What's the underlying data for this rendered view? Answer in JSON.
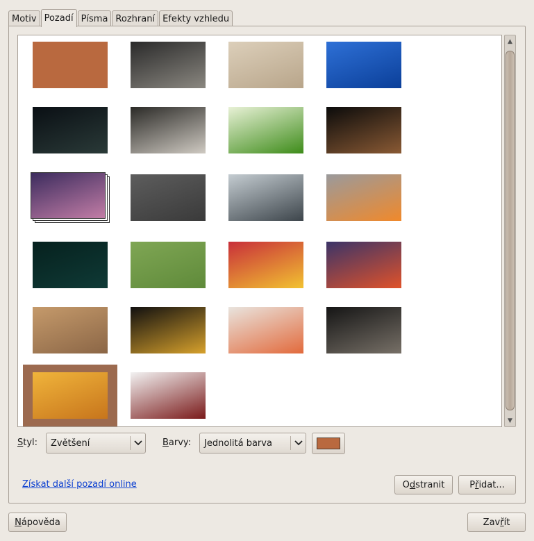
{
  "tabs": [
    {
      "label": "Motiv",
      "active": false
    },
    {
      "label": "Pozadí",
      "active": true
    },
    {
      "label": "Písma",
      "active": false
    },
    {
      "label": "Rozhraní",
      "active": false
    },
    {
      "label": "Efekty vzhledu",
      "active": false
    }
  ],
  "gallery": {
    "selected_index": 20,
    "items": [
      {
        "name": "solid-color",
        "colors": [
          "#b9693f",
          "#b9693f"
        ]
      },
      {
        "name": "dark-clouds-sea",
        "colors": [
          "#2a2a2a",
          "#8a8780"
        ]
      },
      {
        "name": "butterfly-flowers",
        "colors": [
          "#dccfba",
          "#b8a58a"
        ]
      },
      {
        "name": "rock-climber-sky",
        "colors": [
          "#2e70d6",
          "#0b3f99"
        ]
      },
      {
        "name": "water-lily",
        "colors": [
          "#0a0f14",
          "#2a3a38"
        ]
      },
      {
        "name": "hands-holding-frog",
        "colors": [
          "#2b2a27",
          "#cfcac2"
        ]
      },
      {
        "name": "green-grass",
        "colors": [
          "#e8f1d6",
          "#3e8c1a"
        ]
      },
      {
        "name": "cherries-on-crate",
        "colors": [
          "#0b0b0b",
          "#8a5a34"
        ]
      },
      {
        "name": "orion-nebula-stack",
        "colors": [
          "#3c2c5e",
          "#c27da6"
        ]
      },
      {
        "name": "cobblestone-shoes",
        "colors": [
          "#5d5d5d",
          "#3a3a3a"
        ]
      },
      {
        "name": "foggy-pier",
        "colors": [
          "#c4ccd1",
          "#3d454b"
        ]
      },
      {
        "name": "orange-flower",
        "colors": [
          "#9a9a9c",
          "#f0892b"
        ]
      },
      {
        "name": "moonlight-water",
        "colors": [
          "#06211e",
          "#0f3a36"
        ]
      },
      {
        "name": "green-leaf",
        "colors": [
          "#7fa654",
          "#5f8a3a"
        ]
      },
      {
        "name": "red-primrose",
        "colors": [
          "#c82f3a",
          "#f2c231"
        ]
      },
      {
        "name": "sunset-lake",
        "colors": [
          "#3b3468",
          "#e0522a"
        ]
      },
      {
        "name": "sand-dunes",
        "colors": [
          "#c59a6b",
          "#8b6646"
        ]
      },
      {
        "name": "dark-sunset-clouds",
        "colors": [
          "#111010",
          "#d7a12c"
        ]
      },
      {
        "name": "paint-brushes",
        "colors": [
          "#e9e4de",
          "#e26a3c"
        ]
      },
      {
        "name": "splashing-drops",
        "colors": [
          "#151515",
          "#777067"
        ]
      },
      {
        "name": "golden-haze",
        "colors": [
          "#f0b43b",
          "#c7751c"
        ]
      },
      {
        "name": "white-orchid",
        "colors": [
          "#f2f2f2",
          "#7a1a1a"
        ]
      }
    ]
  },
  "style": {
    "label": "Styl:",
    "underline": "S",
    "rest": "tyl:",
    "value": "Zvětšení"
  },
  "colors": {
    "label_underline": "B",
    "label_rest": "arvy:",
    "value": "Jednolitá barva",
    "swatch": "#b9693f"
  },
  "links": {
    "get_more": "Získat další pozadí online"
  },
  "buttons": {
    "remove_pre": "O",
    "remove_u": "d",
    "remove_post": "stranit",
    "add_pre": "P",
    "add_u": "ř",
    "add_post": "idat...",
    "help_u": "N",
    "help_post": "ápověda",
    "close_pre": "Zav",
    "close_u": "ř",
    "close_post": "ít"
  }
}
